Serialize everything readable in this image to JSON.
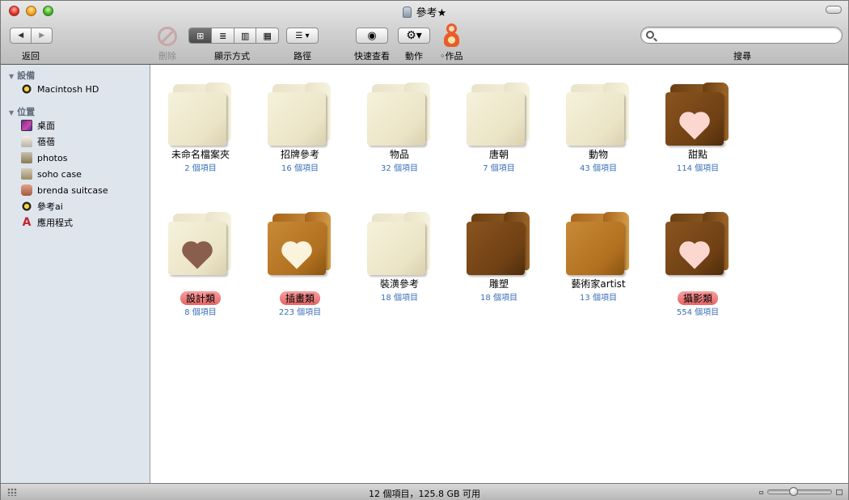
{
  "window": {
    "title": "參考★"
  },
  "toolbar": {
    "back_label": "返回",
    "delete_label": "刪除",
    "view_label": "顯示方式",
    "path_label": "路徑",
    "quicklook_label": "快速查看",
    "action_label": "動作",
    "works_label": "◦作品",
    "search_label": "搜尋",
    "search_value": "",
    "search_placeholder": ""
  },
  "sidebar": {
    "devices_header": "設備",
    "devices": [
      {
        "label": "Macintosh HD",
        "icon": "hard-drive-icon"
      }
    ],
    "places_header": "位置",
    "places": [
      {
        "label": "桌面",
        "icon": "desktop-icon"
      },
      {
        "label": "蓓蓓",
        "icon": "home-icon"
      },
      {
        "label": "photos",
        "icon": "folder-icon"
      },
      {
        "label": "soho case",
        "icon": "folder-icon"
      },
      {
        "label": "brenda suitcase",
        "icon": "suitcase-icon"
      },
      {
        "label": "參考ai",
        "icon": "disk-icon"
      },
      {
        "label": "應用程式",
        "icon": "applications-icon"
      }
    ]
  },
  "items": [
    {
      "name": "未命名檔案夾",
      "count": "2 個項目",
      "color": "cream",
      "heart": "",
      "tag": false
    },
    {
      "name": "招牌參考",
      "count": "16 個項目",
      "color": "cream",
      "heart": "",
      "tag": false
    },
    {
      "name": "物品",
      "count": "32 個項目",
      "color": "cream",
      "heart": "",
      "tag": false
    },
    {
      "name": "唐朝",
      "count": "7 個項目",
      "color": "cream",
      "heart": "",
      "tag": false
    },
    {
      "name": "動物",
      "count": "43 個項目",
      "color": "cream",
      "heart": "",
      "tag": false
    },
    {
      "name": "甜點",
      "count": "114 個項目",
      "color": "dark",
      "heart": "pink",
      "tag": false
    },
    {
      "name": "設計類",
      "count": "8 個項目",
      "color": "cream",
      "heart": "brown",
      "tag": true
    },
    {
      "name": "插畫類",
      "count": "223 個項目",
      "color": "mid",
      "heart": "cream",
      "tag": true
    },
    {
      "name": "裝潢參考",
      "count": "18 個項目",
      "color": "cream",
      "heart": "",
      "tag": false
    },
    {
      "name": "雕塑",
      "count": "18 個項目",
      "color": "dark",
      "heart": "",
      "tag": false
    },
    {
      "name": "藝術家artist",
      "count": "13 個項目",
      "color": "mid",
      "heart": "",
      "tag": false
    },
    {
      "name": "攝影類",
      "count": "554 個項目",
      "color": "dark",
      "heart": "pink",
      "tag": true
    }
  ],
  "status": {
    "text": "12 個項目，125.8 GB 可用"
  },
  "colors": {
    "sidebar_bg": "#dfe5ed",
    "count_text": "#3a6fb8",
    "tag_red": "#e46565"
  }
}
